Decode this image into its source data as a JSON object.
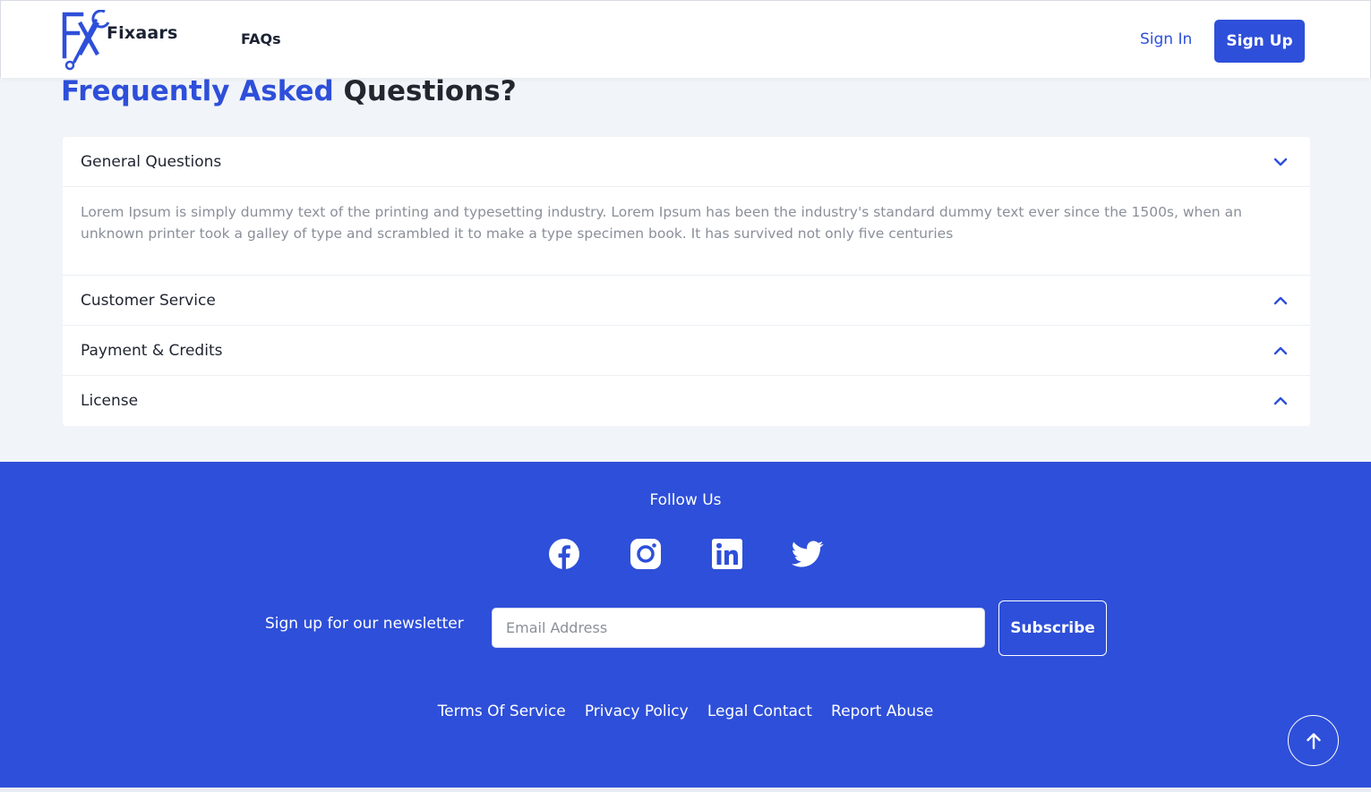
{
  "header": {
    "logo_mark": "FX",
    "logo_text": "Fixaars",
    "nav_faqs": "FAQs",
    "sign_in": "Sign In",
    "sign_up": "Sign Up"
  },
  "title": {
    "accent": "Frequently Asked",
    "rest": "Questions?"
  },
  "faq": {
    "items": [
      {
        "label": "General Questions",
        "expanded": true,
        "icon": "chevron-down-icon",
        "body": "Lorem Ipsum is simply dummy text of the printing and typesetting industry. Lorem Ipsum has been the industry's standard dummy text ever since the 1500s, when an unknown printer took a galley of type and scrambled it to make a type specimen book. It has survived not only five centuries"
      },
      {
        "label": "Customer Service",
        "expanded": false,
        "icon": "chevron-up-icon"
      },
      {
        "label": "Payment & Credits",
        "expanded": false,
        "icon": "chevron-up-icon"
      },
      {
        "label": "License",
        "expanded": false,
        "icon": "chevron-up-icon"
      }
    ]
  },
  "footer": {
    "follow_us": "Follow Us",
    "social": [
      "facebook-icon",
      "instagram-icon",
      "linkedin-icon",
      "twitter-icon"
    ],
    "newsletter_label": "Sign up for our newsletter",
    "email_placeholder": "Email Address",
    "subscribe": "Subscribe",
    "links": [
      "Terms Of Service",
      "Privacy Policy",
      "Legal Contact",
      "Report Abuse"
    ],
    "back_to_top_icon": "arrow-up-icon"
  },
  "colors": {
    "brand": "#2e4fd9",
    "page_bg": "#f1f4f8",
    "text_dark": "#1f2430",
    "text_muted": "#8a8f99"
  }
}
